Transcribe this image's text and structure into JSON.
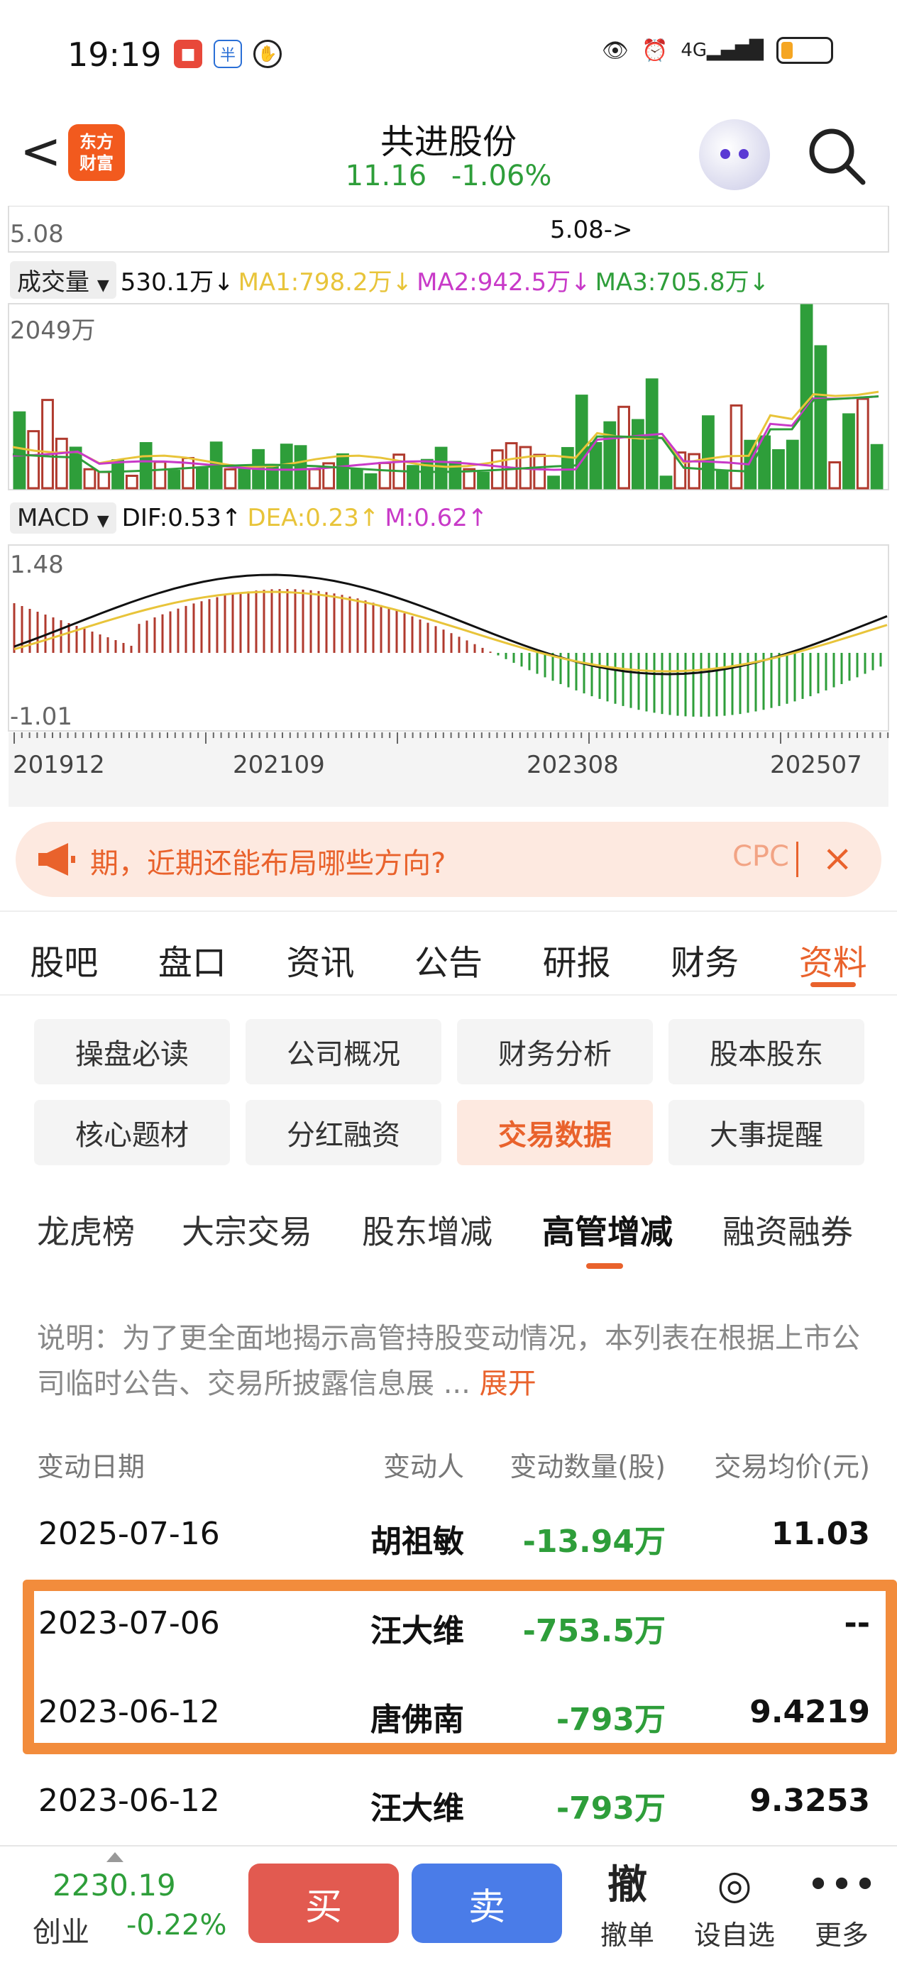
{
  "status_bar": {
    "time": "19:19",
    "network": "4G",
    "icons": [
      "app-notification-icon",
      "app-notification-icon-2",
      "gesture-icon",
      "eye-icon",
      "alarm-icon",
      "signal-icon",
      "battery-icon"
    ]
  },
  "header": {
    "back": "<",
    "app_logo": "东方\n财富",
    "stock_name": "共进股份",
    "price": "11.16",
    "change": "-1.06%"
  },
  "chart": {
    "price_low": "5.08",
    "price_marker": "5.08->",
    "volume_selector": "成交量",
    "volume_value": "530.1万↓",
    "ma1": "MA1:798.2万↓",
    "ma2": "MA2:942.5万↓",
    "ma3": "MA3:705.8万↓",
    "volume_max": "2049万",
    "macd_selector": "MACD",
    "dif": "DIF:0.53↑",
    "dea": "DEA:0.23↑",
    "m": "M:0.62↑",
    "macd_max": "1.48",
    "macd_min": "-1.01",
    "x_labels": [
      "201912",
      "202109",
      "202308",
      "202507"
    ],
    "colors": {
      "up": "#b03a2e",
      "down": "#2e9e3a",
      "ma1": "#e8c43a",
      "ma2": "#c83ac8",
      "ma3": "#2e9e3a"
    }
  },
  "promo": {
    "text": "期，近期还能布局哪些方向?",
    "fade_text": "CPC",
    "close": "×"
  },
  "main_tabs": [
    {
      "label": "股吧"
    },
    {
      "label": "盘口"
    },
    {
      "label": "资讯"
    },
    {
      "label": "公告"
    },
    {
      "label": "研报"
    },
    {
      "label": "财务"
    },
    {
      "label": "资料"
    }
  ],
  "sub_buttons": [
    {
      "label": "操盘必读"
    },
    {
      "label": "公司概况"
    },
    {
      "label": "财务分析"
    },
    {
      "label": "股本股东"
    },
    {
      "label": "核心题材"
    },
    {
      "label": "分红融资"
    },
    {
      "label": "交易数据"
    },
    {
      "label": "大事提醒"
    }
  ],
  "sub_tabs": [
    {
      "label": "龙虎榜"
    },
    {
      "label": "大宗交易"
    },
    {
      "label": "股东增减"
    },
    {
      "label": "高管增减"
    },
    {
      "label": "融资融券"
    }
  ],
  "description": {
    "text": "说明：为了更全面地揭示高管持股变动情况，本列表在根据上市公司临时公告、交易所披露信息展 ... ",
    "expand": "展开"
  },
  "table": {
    "headers": [
      "变动日期",
      "变动人",
      "变动数量(股)",
      "交易均价(元)"
    ],
    "rows": [
      {
        "date": "2025-07-16",
        "person": "胡祖敏",
        "qty": "-13.94万",
        "price": "11.03"
      },
      {
        "date": "2023-07-06",
        "person": "汪大维",
        "qty": "-753.5万",
        "price": "--"
      },
      {
        "date": "2023-06-12",
        "person": "唐佛南",
        "qty": "-793万",
        "price": "9.4219"
      },
      {
        "date": "2023-06-12",
        "person": "汪大维",
        "qty": "-793万",
        "price": "9.3253"
      }
    ]
  },
  "bottom": {
    "index_value": "2230.19",
    "index_name": "创业",
    "index_change": "-0.22%",
    "buy": "买",
    "sell": "卖",
    "actions": [
      {
        "icon": "撤",
        "label": "撤单"
      },
      {
        "icon": "◎",
        "label": "设自选"
      },
      {
        "icon": "•••",
        "label": "更多"
      }
    ]
  }
}
